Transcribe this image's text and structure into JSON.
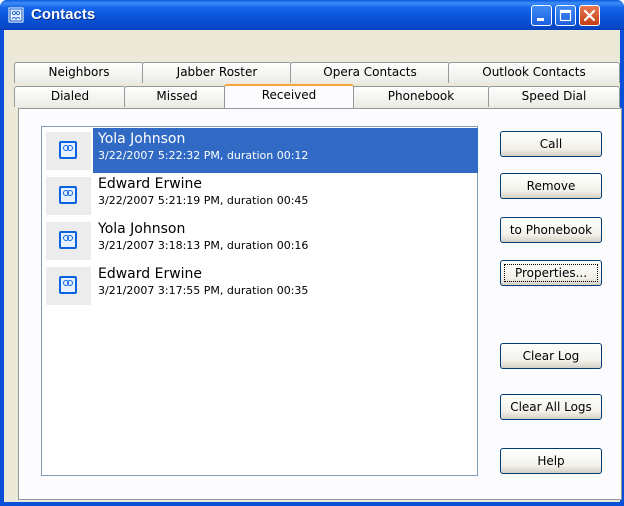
{
  "window": {
    "title": "Contacts",
    "accent": "#0a4fd8",
    "icon": "contacts-app-icon"
  },
  "tabs_row1": [
    {
      "label": "Neighbors"
    },
    {
      "label": "Jabber Roster"
    },
    {
      "label": "Opera Contacts"
    },
    {
      "label": "Outlook Contacts"
    }
  ],
  "tabs_row2": [
    {
      "label": "Dialed"
    },
    {
      "label": "Missed"
    },
    {
      "label": "Received",
      "active": true
    },
    {
      "label": "Phonebook"
    },
    {
      "label": "Speed Dial"
    }
  ],
  "call_log": [
    {
      "name": "Yola Johnson",
      "detail": "3/22/2007 5:22:32 PM, duration 00:12",
      "selected": true
    },
    {
      "name": "Edward Erwine",
      "detail": "3/22/2007 5:21:19 PM, duration 00:45"
    },
    {
      "name": "Yola Johnson",
      "detail": "3/21/2007 3:18:13 PM, duration 00:16"
    },
    {
      "name": "Edward Erwine",
      "detail": "3/21/2007 3:17:55 PM, duration 00:35"
    }
  ],
  "buttons": {
    "call": "Call",
    "remove": "Remove",
    "to_phonebook": "to Phonebook",
    "properties": "Properties...",
    "clear_log": "Clear Log",
    "clear_all_logs": "Clear All Logs",
    "help": "Help"
  },
  "colors": {
    "selection": "#316ac5",
    "active_tab_highlight": "#f6a43c",
    "close_button": "#c33d12"
  }
}
